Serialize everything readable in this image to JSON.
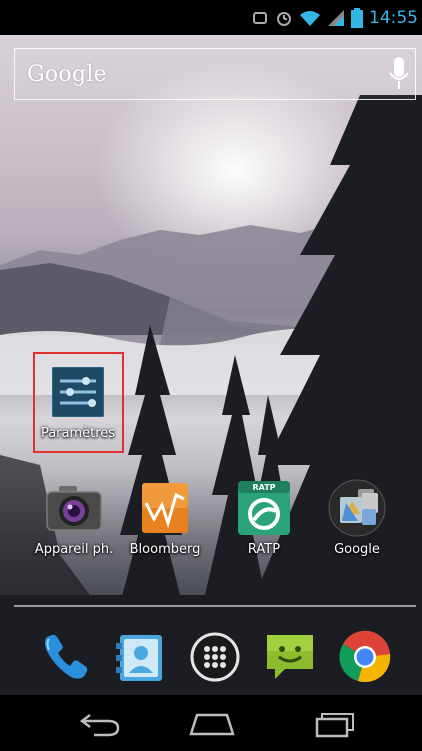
{
  "status_bar": {
    "time": "14:55",
    "icons": [
      "sync-icon",
      "alarm-icon",
      "wifi-icon",
      "signal-icon",
      "battery-icon"
    ]
  },
  "search": {
    "logo": "Google",
    "icons": [
      "mic-icon"
    ]
  },
  "homescreen": {
    "apps": [
      {
        "label": "Paramètres",
        "icon": "settings-icon",
        "selected": true
      },
      {
        "label": "Appareil ph.",
        "icon": "camera-icon"
      },
      {
        "label": "Bloomberg",
        "icon": "bloomberg-icon"
      },
      {
        "label": "RATP",
        "icon": "ratp-icon",
        "badge": "RATP"
      },
      {
        "label": "Google",
        "icon": "google-folder-icon"
      }
    ]
  },
  "dock": {
    "items": [
      {
        "icon": "phone-icon"
      },
      {
        "icon": "contacts-icon"
      },
      {
        "icon": "all-apps-icon"
      },
      {
        "icon": "messaging-icon"
      },
      {
        "icon": "chrome-icon"
      }
    ]
  },
  "nav_bar": {
    "items": [
      {
        "icon": "back-icon"
      },
      {
        "icon": "home-icon"
      },
      {
        "icon": "recents-icon"
      }
    ]
  },
  "colors": {
    "status_accent": "#33b5e5",
    "selection_border": "#e0312e"
  }
}
